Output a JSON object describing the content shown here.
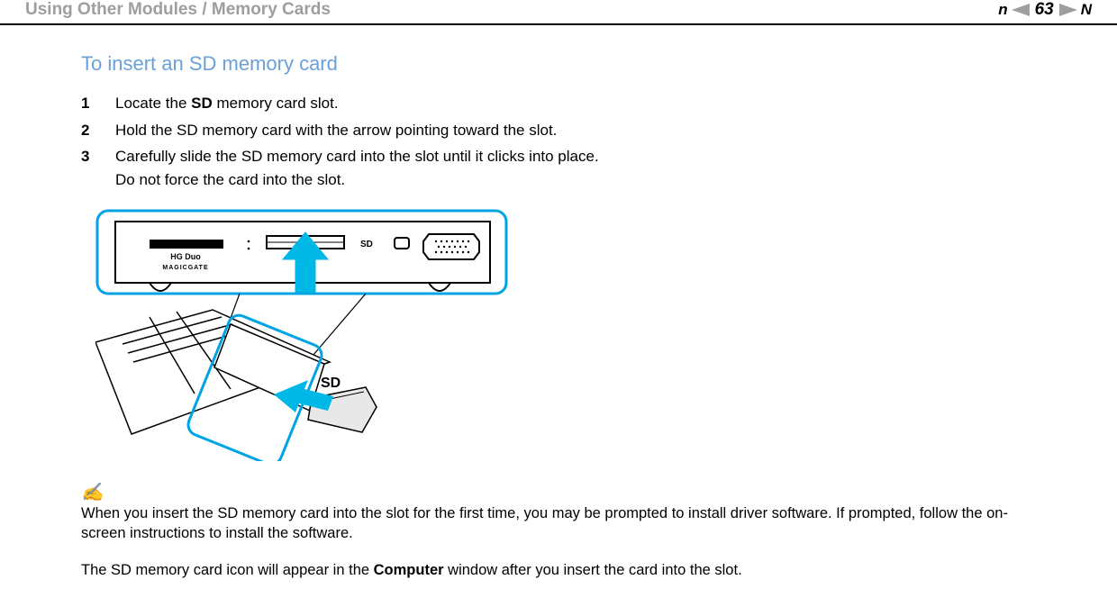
{
  "header": {
    "breadcrumb": "Using Other Modules / Memory Cards",
    "page_number": "63",
    "nav_prev_label": "n",
    "nav_next_label": "N"
  },
  "section": {
    "title": "To insert an SD memory card",
    "steps": [
      {
        "num": "1",
        "before": "Locate the ",
        "bold": "SD",
        "after": " memory card slot."
      },
      {
        "num": "2",
        "before": "Hold the SD memory card with the arrow pointing toward the slot.",
        "bold": "",
        "after": ""
      },
      {
        "num": "3",
        "before": "Carefully slide the SD memory card into the slot until it clicks into place.",
        "bold": "",
        "after": "",
        "sub": "Do not force the card into the slot."
      }
    ]
  },
  "illustration": {
    "callout_top_slot_label": "SD",
    "callout_top_other_label": "HG Duo",
    "callout_top_other_sub": "MAGICGATE",
    "callout_side_label": "SD"
  },
  "notes": {
    "icon": "✍",
    "first_before": "When you insert the SD memory card into the slot for the first time, you may be prompted to install driver software. If prompted, follow the on-screen instructions to install the software.",
    "second_before": "The SD memory card icon will appear in the ",
    "second_bold": "Computer",
    "second_after": " window after you insert the card into the slot."
  }
}
